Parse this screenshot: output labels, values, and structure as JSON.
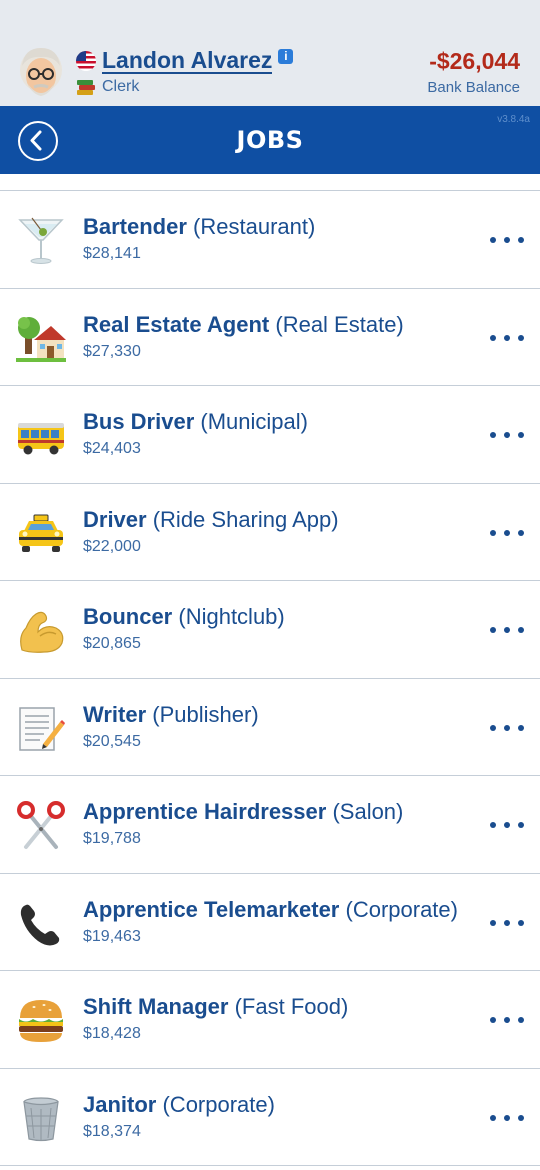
{
  "header": {
    "name": "Landon Alvarez",
    "info_badge": "i",
    "role": "Clerk",
    "balance": "-$26,044",
    "balance_label": "Bank Balance"
  },
  "titlebar": {
    "title": "JOBS",
    "version": "v3.8.4a"
  },
  "jobs": [
    {
      "title": "Bartender",
      "employer": "(Restaurant)",
      "salary": "$28,141",
      "icon": "cocktail-icon"
    },
    {
      "title": "Real Estate Agent",
      "employer": "(Real Estate)",
      "salary": "$27,330",
      "icon": "house-icon"
    },
    {
      "title": "Bus Driver",
      "employer": "(Municipal)",
      "salary": "$24,403",
      "icon": "bus-icon"
    },
    {
      "title": "Driver",
      "employer": "(Ride Sharing App)",
      "salary": "$22,000",
      "icon": "taxi-icon"
    },
    {
      "title": "Bouncer",
      "employer": "(Nightclub)",
      "salary": "$20,865",
      "icon": "flexed-biceps-icon"
    },
    {
      "title": "Writer",
      "employer": "(Publisher)",
      "salary": "$20,545",
      "icon": "memo-icon"
    },
    {
      "title": "Apprentice Hairdresser",
      "employer": "(Salon)",
      "salary": "$19,788",
      "icon": "scissors-icon"
    },
    {
      "title": "Apprentice Telemarketer",
      "employer": "(Corporate)",
      "salary": "$19,463",
      "icon": "telephone-icon"
    },
    {
      "title": "Shift Manager",
      "employer": "(Fast Food)",
      "salary": "$18,428",
      "icon": "hamburger-icon"
    },
    {
      "title": "Janitor",
      "employer": "(Corporate)",
      "salary": "$18,374",
      "icon": "wastebasket-icon"
    }
  ],
  "colors": {
    "brand_blue": "#0f4fa3",
    "text_blue": "#1a4d8f",
    "negative_red": "#b32a1a",
    "header_bg": "#e6eaef"
  }
}
